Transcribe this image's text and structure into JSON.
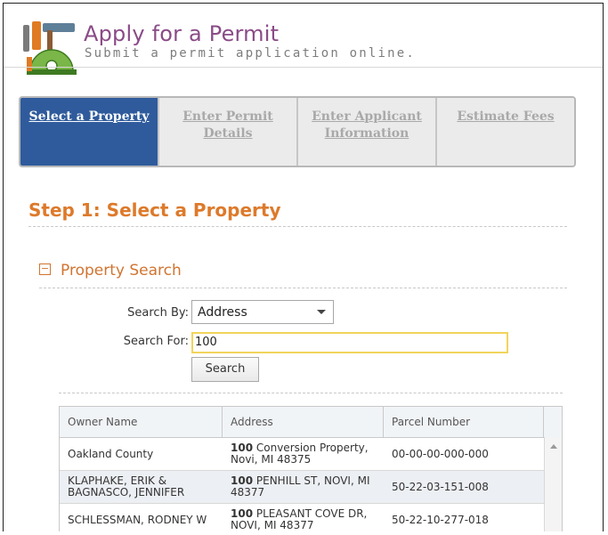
{
  "header": {
    "title": "Apply for a Permit",
    "subtitle": "Submit a permit application online."
  },
  "steps": [
    {
      "label": "Select a Property",
      "active": true
    },
    {
      "label": "Enter Permit Details",
      "active": false
    },
    {
      "label": "Enter Applicant Information",
      "active": false
    },
    {
      "label": "Estimate Fees",
      "active": false
    }
  ],
  "step_heading": "Step 1: Select a Property",
  "section": {
    "toggle": "−",
    "title": "Property Search"
  },
  "form": {
    "search_by_label": "Search By:",
    "search_by_value": "Address",
    "search_for_label": "Search For:",
    "search_for_value": "100",
    "search_button": "Search"
  },
  "table": {
    "columns": [
      "Owner Name",
      "Address",
      "Parcel Number"
    ],
    "rows": [
      {
        "owner": "Oakland County",
        "addr_num": "100",
        "addr_rest": " Conversion Property, Novi, MI 48375",
        "parcel": "00-00-00-000-000"
      },
      {
        "owner": "KLAPHAKE, ERIK & BAGNASCO, JENNIFER",
        "addr_num": "100",
        "addr_rest": " PENHILL ST, NOVI, MI 48377",
        "parcel": "50-22-03-151-008"
      },
      {
        "owner": "SCHLESSMAN, RODNEY W",
        "addr_num": "100",
        "addr_rest": " PLEASANT COVE DR, NOVI, MI 48377",
        "parcel": "50-22-10-277-018"
      }
    ]
  },
  "colors": {
    "title": "#8a4b87",
    "active_step": "#2f5b9c",
    "heading": "#dd7a2b",
    "input_focus": "#f1d45b"
  },
  "icons": {
    "logo": "permit-tools-logo-icon",
    "select_caret": "chevron-down-icon",
    "scroll_up": "scroll-up-arrow-icon"
  }
}
